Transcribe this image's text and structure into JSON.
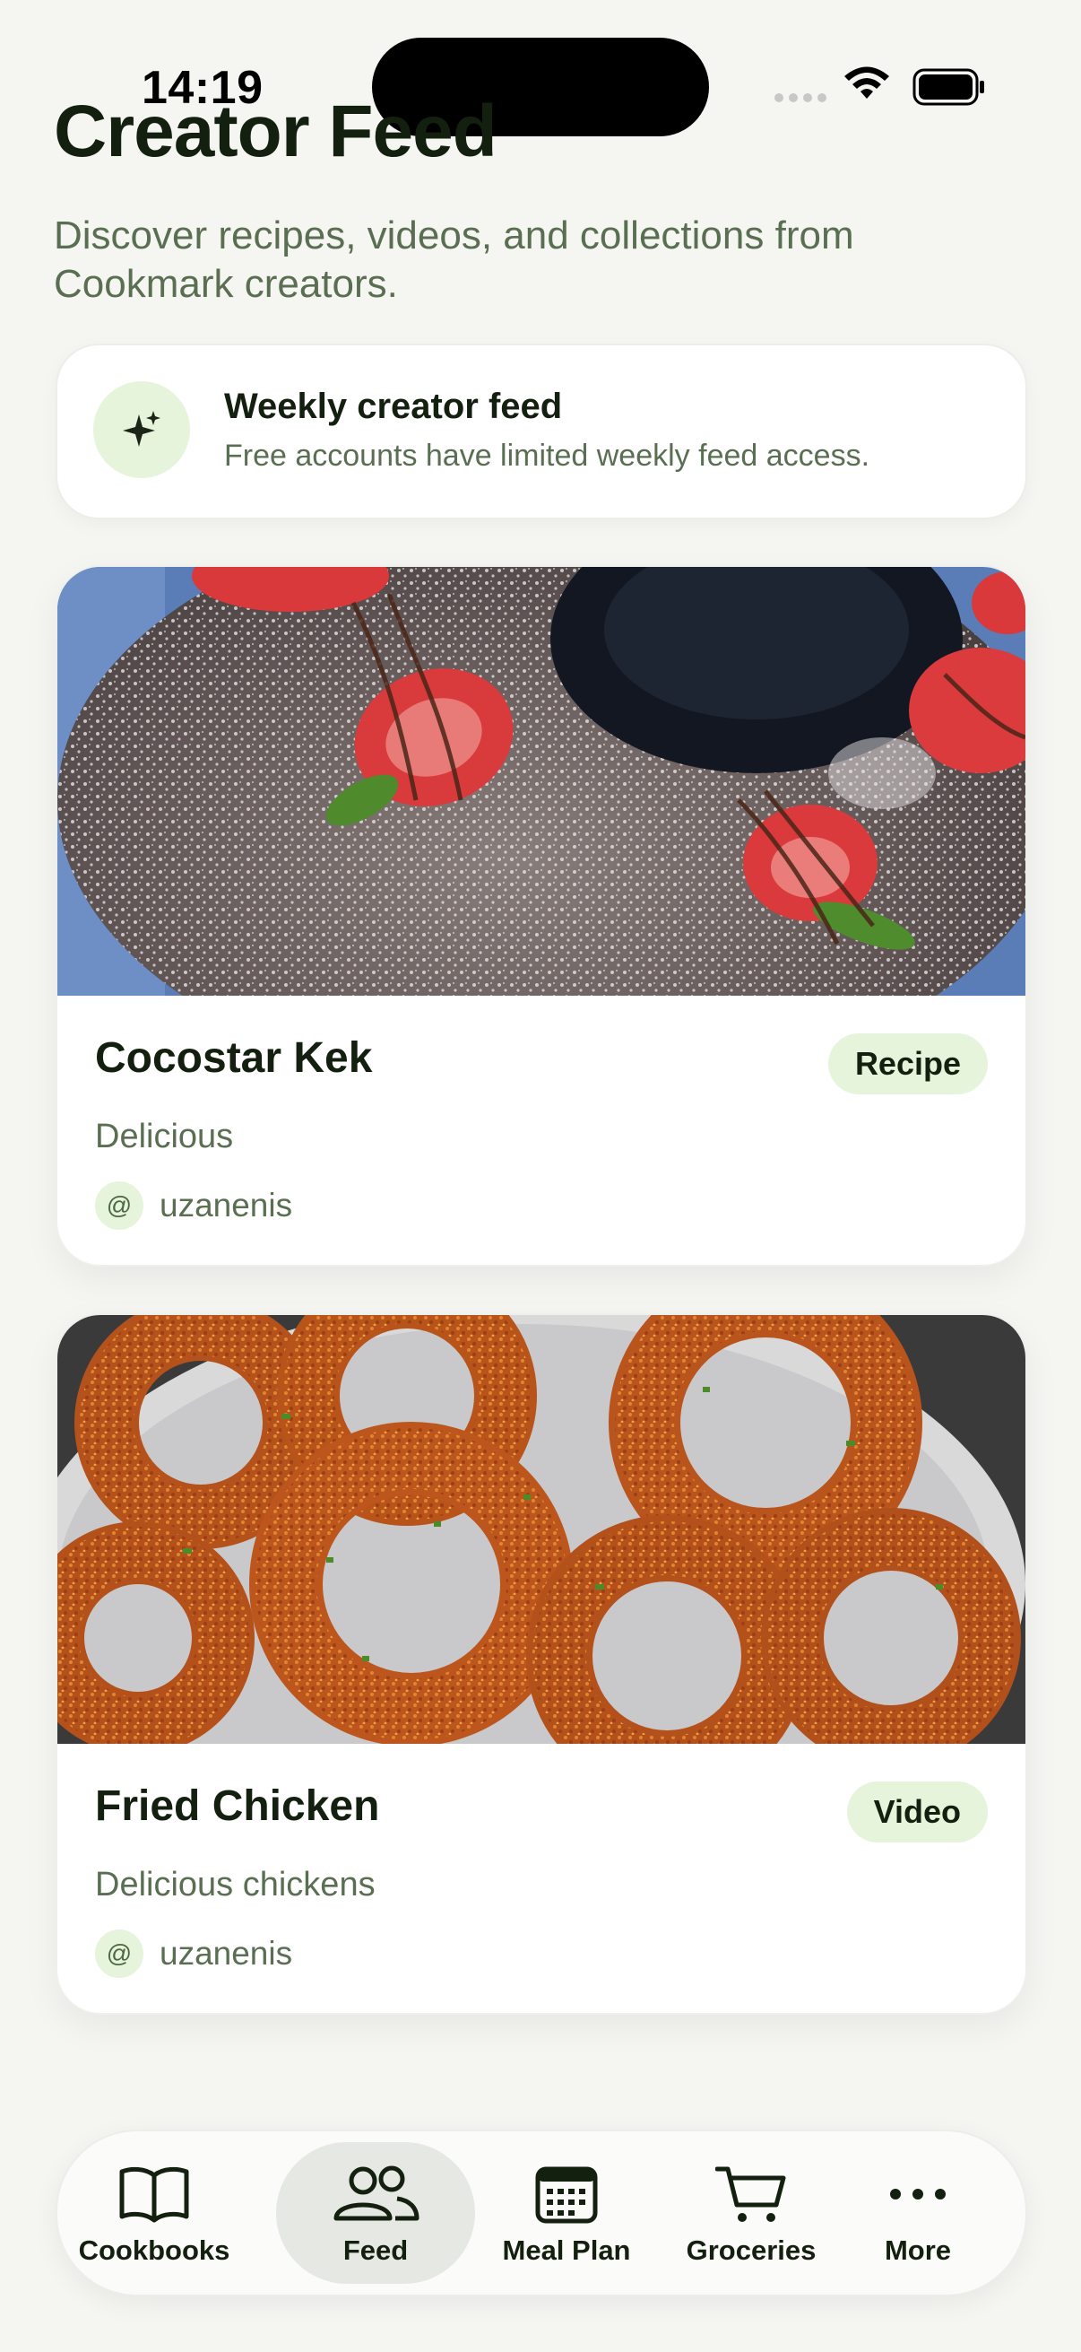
{
  "status_bar": {
    "time": "14:19"
  },
  "header": {
    "title": "Creator Feed",
    "subtitle": "Discover recipes, videos, and collections from Cookmark creators."
  },
  "banner": {
    "icon": "sparkle-icon",
    "title": "Weekly creator feed",
    "text": "Free accounts have limited weekly feed access."
  },
  "feed": {
    "items": [
      {
        "title": "Cocostar Kek",
        "badge": "Recipe",
        "description": "Delicious",
        "author": "uzanenis",
        "image": "bundt-cake-with-strawberries"
      },
      {
        "title": "Fried Chicken",
        "badge": "Video",
        "description": "Delicious chickens",
        "author": "uzanenis",
        "image": "fried-onion-rings"
      }
    ]
  },
  "tab_bar": {
    "active": "Feed",
    "tabs": [
      {
        "label": "Cookbooks",
        "icon": "book-icon"
      },
      {
        "label": "Feed",
        "icon": "people-icon"
      },
      {
        "label": "Meal Plan",
        "icon": "calendar-icon"
      },
      {
        "label": "Groceries",
        "icon": "cart-icon"
      },
      {
        "label": "More",
        "icon": "ellipsis-icon"
      }
    ]
  },
  "colors": {
    "accent_bg": "#e7f4dc",
    "text_primary": "#14200f",
    "text_secondary": "#5a6f52",
    "background": "#f5f5f2"
  }
}
